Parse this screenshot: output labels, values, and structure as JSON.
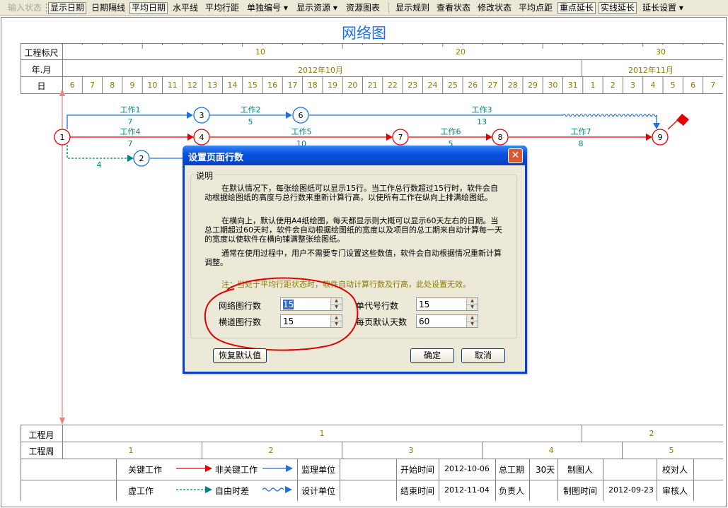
{
  "toolbar": {
    "items": [
      {
        "label": "输入状态",
        "disabled": true
      },
      {
        "label": "显示日期",
        "pressed": true
      },
      {
        "label": "日期隔线"
      },
      {
        "label": "平均日期",
        "pressed": true
      },
      {
        "label": "水平线"
      },
      {
        "label": "平均行距"
      },
      {
        "label": "单独编号 ▾"
      },
      {
        "label": "显示资源 ▾"
      },
      {
        "label": "资源图表"
      },
      {
        "label": "显示规则"
      },
      {
        "label": "查看状态"
      },
      {
        "label": "修改状态"
      },
      {
        "label": "平均点距"
      },
      {
        "label": "重点延长",
        "pressed": true
      },
      {
        "label": "实线延长",
        "pressed": true
      },
      {
        "label": "延长设置 ▾"
      }
    ]
  },
  "chart": {
    "title": "网络图",
    "rows": {
      "scale_label": "工程标尺",
      "month_label": "年.月",
      "day_label": "日",
      "project_month_label": "工程月",
      "project_week_label": "工程周"
    },
    "scale_ticks": [
      "10",
      "20",
      "30"
    ],
    "months": [
      "2012年10月",
      "2012年11月"
    ],
    "days": [
      "6",
      "7",
      "8",
      "9",
      "10",
      "11",
      "12",
      "13",
      "14",
      "15",
      "16",
      "17",
      "18",
      "19",
      "20",
      "21",
      "22",
      "23",
      "24",
      "25",
      "26",
      "27",
      "28",
      "29",
      "30",
      "31",
      "1",
      "2",
      "3",
      "4",
      "5",
      "6",
      "7"
    ],
    "project_months": [
      "1",
      "2"
    ],
    "project_weeks": [
      "1",
      "2",
      "3",
      "4",
      "5"
    ],
    "nodes": [
      "1",
      "2",
      "3",
      "4",
      "6",
      "7",
      "8",
      "9"
    ],
    "activities": [
      {
        "name": "工作1",
        "duration": "7"
      },
      {
        "name": "工作2",
        "duration": "5"
      },
      {
        "name": "工作3",
        "duration": "13"
      },
      {
        "name": "工作4",
        "duration": "7"
      },
      {
        "name": "工作5",
        "duration": "10"
      },
      {
        "name": "工作6",
        "duration": "5"
      },
      {
        "name": "工作7",
        "duration": "8"
      },
      {
        "name": "",
        "duration": "4"
      }
    ],
    "colors": {
      "critical": "#e00000",
      "noncritical": "#1e6fe0",
      "float": "#008080",
      "text": "#8b7b00"
    }
  },
  "legend": {
    "critical": "关键工作",
    "noncritical": "非关键工作",
    "dummy": "虚工作",
    "free_float": "自由时差",
    "supervisor": "监理单位",
    "designer": "设计单位",
    "start_label": "开始时间",
    "start_value": "2012-10-06",
    "end_label": "结束时间",
    "end_value": "2012-11-04",
    "total_label": "总工期",
    "total_value": "30天",
    "owner_label": "负责人",
    "drawer_label": "制图人",
    "drawtime_label": "制图时间",
    "drawtime_value": "2012-09-23",
    "checker_label": "校对人",
    "approver_label": "审核人"
  },
  "dialog": {
    "title": "设置页面行数",
    "close": "✕",
    "group_label": "说明",
    "para1": "在默认情况下，每张绘图纸可以显示15行。当工作总行数超过15行时，软件会自动根据绘图纸的高度与总行数来重新计算行高，以使所有工作在纵向上排满绘图纸。",
    "para2": "在横向上，默认使用A4纸绘图，每天都显示则大概可以显示60天左右的日期。当总工期超过60天时，软件会自动根据绘图纸的宽度以及项目的总工期来自动计算每一天的宽度以使软件在横向铺满整张绘图纸。",
    "para3": "通常在使用过程中，用户不需要专门设置这些数值，软件会自动根据情况重新计算调整。",
    "note": "注：当处于平均行距状态时，软件自动计算行数及行高，此处设置无效。",
    "net_rows_label": "网络图行数",
    "net_rows_value": "15",
    "lane_rows_label": "横道图行数",
    "lane_rows_value": "15",
    "code_rows_label": "单代号行数",
    "code_rows_value": "15",
    "days_per_page_label": "每页默认天数",
    "days_per_page_value": "60",
    "restore_button": "恢复默认值",
    "ok_button": "确定",
    "cancel_button": "取消"
  }
}
